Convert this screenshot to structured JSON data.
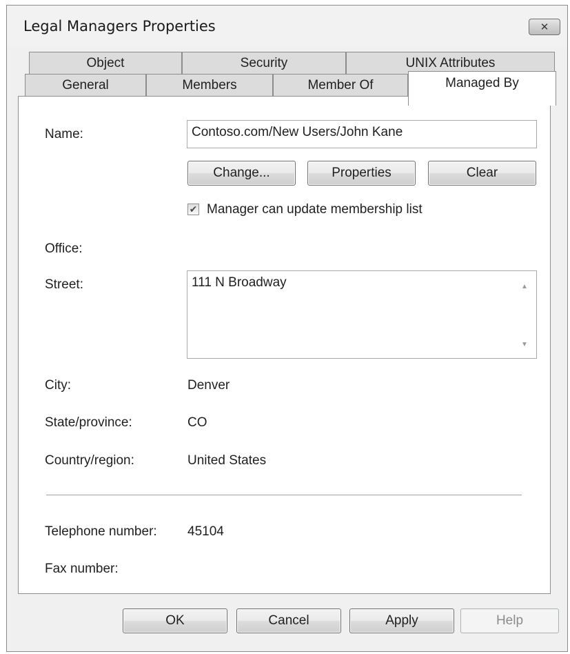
{
  "window": {
    "title": "Legal Managers Properties",
    "close_icon": "close-icon"
  },
  "tabs_row1": [
    {
      "label": "Object"
    },
    {
      "label": "Security"
    },
    {
      "label": "UNIX Attributes"
    }
  ],
  "tabs_row2": [
    {
      "label": "General"
    },
    {
      "label": "Members"
    },
    {
      "label": "Member Of"
    },
    {
      "label": "Managed By",
      "active": true
    }
  ],
  "form": {
    "name_label": "Name:",
    "name_value": "Contoso.com/New Users/John Kane",
    "change_button": "Change...",
    "properties_button": "Properties",
    "clear_button": "Clear",
    "manager_update_checkbox_label": "Manager can update membership list",
    "manager_update_checked": true,
    "office_label": "Office:",
    "office_value": "",
    "street_label": "Street:",
    "street_value": "111 N Broadway",
    "city_label": "City:",
    "city_value": "Denver",
    "state_label": "State/province:",
    "state_value": "CO",
    "country_label": "Country/region:",
    "country_value": "United States",
    "telephone_label": "Telephone number:",
    "telephone_value": "45104",
    "fax_label": "Fax number:",
    "fax_value": ""
  },
  "footer": {
    "ok": "OK",
    "cancel": "Cancel",
    "apply": "Apply",
    "help": "Help"
  },
  "colors": {
    "dialog_background": "#f0f0f0",
    "panel_background": "#ffffff",
    "disabled_text": "#8c8c8c"
  }
}
